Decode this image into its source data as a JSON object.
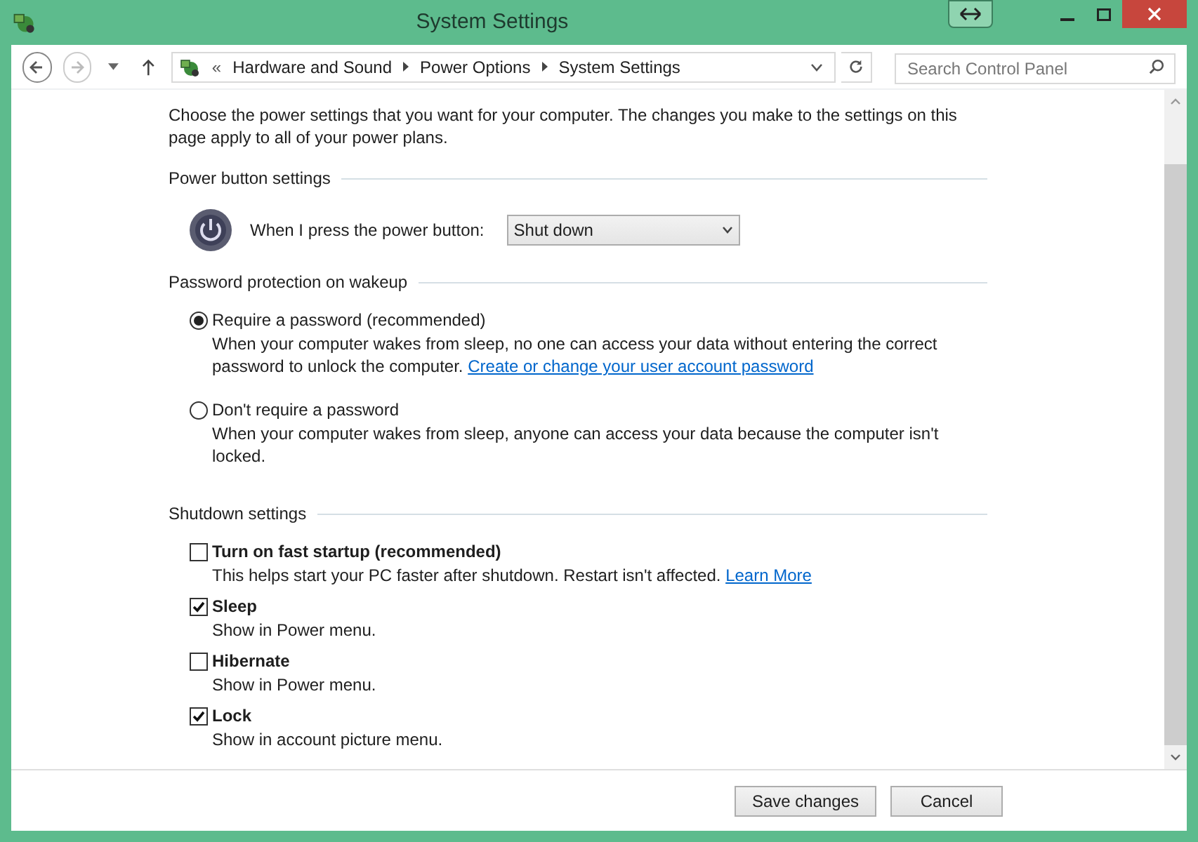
{
  "window": {
    "title": "System Settings"
  },
  "address_bar": {
    "overflow": "«",
    "breadcrumbs": [
      "Hardware and Sound",
      "Power Options",
      "System Settings"
    ]
  },
  "search": {
    "placeholder": "Search Control Panel"
  },
  "intro": "Choose the power settings that you want for your computer. The changes you make to the settings on this page apply to all of your power plans.",
  "power_button_settings": {
    "heading": "Power button settings",
    "label": "When I press the power button:",
    "value": "Shut down"
  },
  "password_protection": {
    "heading": "Password protection on wakeup",
    "options": [
      {
        "label": "Require a password (recommended)",
        "description": "When your computer wakes from sleep, no one can access your data without entering the correct password to unlock the computer.",
        "link": "Create or change your user account password",
        "selected": true
      },
      {
        "label": "Don't require a password",
        "description": "When your computer wakes from sleep, anyone can access your data because the computer isn't locked.",
        "selected": false
      }
    ]
  },
  "shutdown_settings": {
    "heading": "Shutdown settings",
    "items": [
      {
        "label": "Turn on fast startup (recommended)",
        "description": "This helps start your PC faster after shutdown. Restart isn't affected.",
        "link": "Learn More",
        "checked": false
      },
      {
        "label": "Sleep",
        "description": "Show in Power menu.",
        "checked": true
      },
      {
        "label": "Hibernate",
        "description": "Show in Power menu.",
        "checked": false
      },
      {
        "label": "Lock",
        "description": "Show in account picture menu.",
        "checked": true
      }
    ]
  },
  "buttons": [
    "Save changes",
    "Cancel"
  ]
}
